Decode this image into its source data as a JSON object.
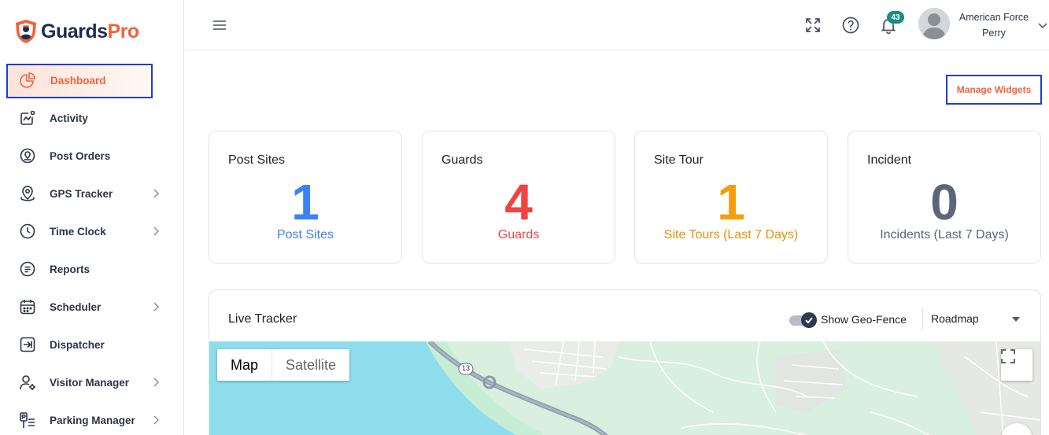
{
  "brand": {
    "name_part1": "Guards",
    "name_part2": "Pro"
  },
  "sidebar": {
    "items": [
      {
        "label": "Dashboard",
        "icon": "pie-chart-icon",
        "active": true,
        "has_submenu": false
      },
      {
        "label": "Activity",
        "icon": "activity-icon",
        "has_submenu": false
      },
      {
        "label": "Post Orders",
        "icon": "post-orders-icon",
        "has_submenu": false
      },
      {
        "label": "GPS Tracker",
        "icon": "map-pin-icon",
        "has_submenu": true
      },
      {
        "label": "Time Clock",
        "icon": "clock-icon",
        "has_submenu": true
      },
      {
        "label": "Reports",
        "icon": "report-icon",
        "has_submenu": false
      },
      {
        "label": "Scheduler",
        "icon": "calendar-icon",
        "has_submenu": true
      },
      {
        "label": "Dispatcher",
        "icon": "dispatch-icon",
        "has_submenu": false
      },
      {
        "label": "Visitor Manager",
        "icon": "visitor-icon",
        "has_submenu": true
      },
      {
        "label": "Parking Manager",
        "icon": "parking-icon",
        "has_submenu": true
      }
    ]
  },
  "topbar": {
    "notification_count": "43",
    "user": {
      "line1": "American Force",
      "line2": "Perry"
    }
  },
  "main": {
    "manage_widgets_label": "Manage Widgets",
    "cards": [
      {
        "title": "Post Sites",
        "value": "1",
        "subtitle": "Post Sites",
        "color": "#3b82f6"
      },
      {
        "title": "Guards",
        "value": "4",
        "subtitle": "Guards",
        "color": "#ef4444"
      },
      {
        "title": "Site Tour",
        "value": "1",
        "subtitle": "Site Tours (Last 7 Days)",
        "color": "#f59e0b"
      },
      {
        "title": "Incident",
        "value": "0",
        "subtitle": "Incidents (Last 7 Days)",
        "color": "#5b6678"
      }
    ],
    "tracker": {
      "title": "Live Tracker",
      "geofence_label": "Show Geo-Fence",
      "geofence_on": true,
      "map_style": "Roadmap",
      "map_type_options": [
        "Map",
        "Satellite"
      ],
      "route_marker": "13"
    }
  },
  "colors": {
    "accent": "#f0633a",
    "highlight_border": "#1c3fd0",
    "navy": "#1f2d4d",
    "badge": "#1a8f7a"
  }
}
